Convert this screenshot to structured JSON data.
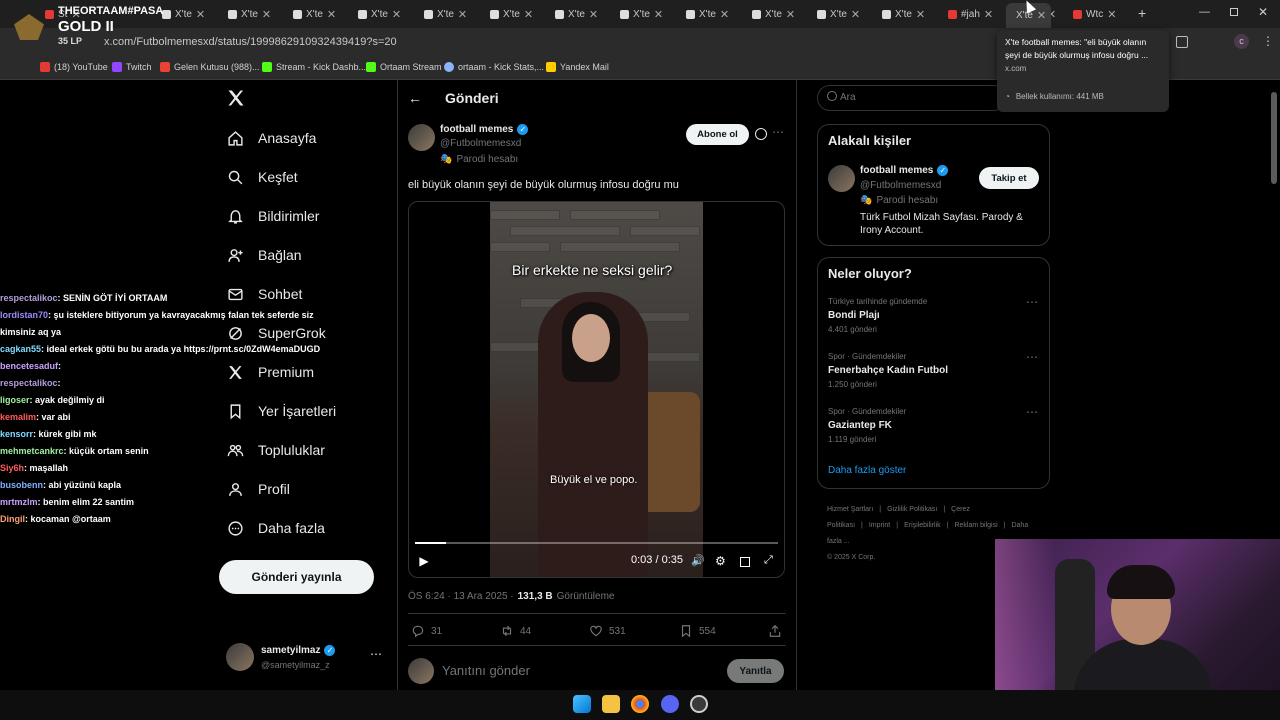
{
  "browser": {
    "tabs": [
      {
        "label": "St"
      },
      {
        "label": "X'te"
      },
      {
        "label": "X'te"
      },
      {
        "label": "X'te"
      },
      {
        "label": "X'te"
      },
      {
        "label": "X'te"
      },
      {
        "label": "X'te"
      },
      {
        "label": "X'te"
      },
      {
        "label": "X'te"
      },
      {
        "label": "X'te"
      },
      {
        "label": "X'te"
      },
      {
        "label": "X'te"
      },
      {
        "label": "X'te"
      },
      {
        "label": "#jah"
      },
      {
        "label": "X'te"
      },
      {
        "label": "X'te"
      },
      {
        "label": "Wtc"
      }
    ],
    "url": "x.com/Futbolmemesxd/status/1999862910932439419?s=20",
    "bookmarks": [
      "(18) YouTube",
      "Twitch",
      "Gelen Kutusu (988)...",
      "Stream - Kick Dashb...",
      "Ortaam Stream",
      "ortaam - Kick Stats,...",
      "Yandex Mail"
    ],
    "tooltip": {
      "title": "X'te football memes: \"eli büyük olanın şeyi de büyük olurmuş infosu doğru ...",
      "domain": "x.com",
      "memory": "Bellek kullanımı: 441 MB"
    }
  },
  "overlay": {
    "rank_title": "THEORTAAM#PASA",
    "rank_tier": "GOLD II",
    "rank_lp": "35 LP",
    "chat": [
      {
        "user": "respectalikoc",
        "color": "#b39ddb",
        "msg": ": SENİN GÖT İYİ ORTAAM"
      },
      {
        "user": "lordistan70",
        "color": "#9c8cff",
        "msg": ": şu isteklere bitiyorum ya kavrayacakmış falan tek seferde siz kimsiniz aq ya"
      },
      {
        "user": "cagkan55",
        "color": "#7fdcff",
        "msg": ": ideal erkek götü bu bu arada ya https://prnt.sc/0ZdW4emaDUGD"
      },
      {
        "user": "bencetesaduf",
        "color": "#c8a2ff",
        "msg": ":"
      },
      {
        "user": "respectalikoc",
        "color": "#b39ddb",
        "msg": ":"
      },
      {
        "user": "ligoser",
        "color": "#9ff29f",
        "msg": ": ayak değilmiy di"
      },
      {
        "user": "kemalim",
        "color": "#ff5c5c",
        "msg": ": var abi"
      },
      {
        "user": "kensorr",
        "color": "#7fdcff",
        "msg": ": kürek gibi mk"
      },
      {
        "user": "mehmetcankrc",
        "color": "#9ff29f",
        "msg": ": küçük ortam senin"
      },
      {
        "user": "Siy6h",
        "color": "#ff5c5c",
        "msg": ": maşallah"
      },
      {
        "user": "busobenn",
        "color": "#7fb0ff",
        "msg": ": abi yüzünü kapla"
      },
      {
        "user": "mrtmzlm",
        "color": "#c8a2ff",
        "msg": ": benim elim 22 santim"
      },
      {
        "user": "Dingil",
        "color": "#ffa07a",
        "msg": ": kocaman @ortaam"
      }
    ]
  },
  "sidebar": {
    "items": [
      {
        "label": "Anasayfa",
        "icon": "home-icon"
      },
      {
        "label": "Keşfet",
        "icon": "search-icon"
      },
      {
        "label": "Bildirimler",
        "icon": "bell-icon"
      },
      {
        "label": "Bağlan",
        "icon": "add-person-icon"
      },
      {
        "label": "Sohbet",
        "icon": "mail-icon"
      },
      {
        "label": "SuperGrok",
        "icon": "grok-icon"
      },
      {
        "label": "Premium",
        "icon": "x-logo-icon"
      },
      {
        "label": "Yer İşaretleri",
        "icon": "bookmark-icon"
      },
      {
        "label": "Topluluklar",
        "icon": "people-icon"
      },
      {
        "label": "Profil",
        "icon": "person-icon"
      },
      {
        "label": "Daha fazla",
        "icon": "more-circle-icon"
      }
    ],
    "post_button": "Gönderi yayınla",
    "account": {
      "name": "sametyilmaz",
      "handle": "@sametyilmaz_z"
    }
  },
  "post": {
    "header": "Gönderi",
    "author": {
      "name": "football memes",
      "handle": "@Futbolmemesxd",
      "label": "Parodi hesabı"
    },
    "subscribe": "Abone ol",
    "text": "eli büyük olanın şeyi de büyük olurmuş infosu doğru mu",
    "video": {
      "caption_top": "Bir erkekte ne seksi gelir?",
      "caption_bottom": "Büyük el ve popo.",
      "time": "0:03 / 0:35",
      "progress": 0.086
    },
    "meta": {
      "time": "ÖS 6:24 · 13 Ara 2025 ·",
      "views": "131,3 B",
      "views_label": "Görüntüleme"
    },
    "actions": {
      "replies": "31",
      "reposts": "44",
      "likes": "531",
      "bookmarks": "554"
    },
    "reply_placeholder": "Yanıtını gönder",
    "reply_button": "Yanıtla"
  },
  "right": {
    "search_placeholder": "Ara",
    "relevant": {
      "title": "Alakalı kişiler",
      "name": "football memes",
      "handle": "@Futbolmemesxd",
      "label": "Parodi hesabı",
      "bio": "Türk Futbol Mizah Sayfası. Parody & Irony Account.",
      "follow": "Takip et"
    },
    "trends": {
      "title": "Neler oluyor?",
      "items": [
        {
          "meta": "Türkiye tarihinde gündemde",
          "title": "Bondi Plajı",
          "count": "4.401 gönderi"
        },
        {
          "meta": "Spor · Gündemdekiler",
          "title": "Fenerbahçe Kadın Futbol",
          "count": "1.250 gönderi"
        },
        {
          "meta": "Spor · Gündemdekiler",
          "title": "Gaziantep FK",
          "count": "1.119 gönderi"
        }
      ],
      "more": "Daha fazla göster"
    },
    "footer": [
      "Hizmet Şartları",
      "|",
      "Gizlilik Politikası",
      "|",
      "Çerez Politikası",
      "|",
      "Imprint",
      "|",
      "Erişilebilirlik",
      "|",
      "Reklam bilgisi",
      "|",
      "Daha fazla ...",
      "© 2025 X Corp."
    ]
  }
}
